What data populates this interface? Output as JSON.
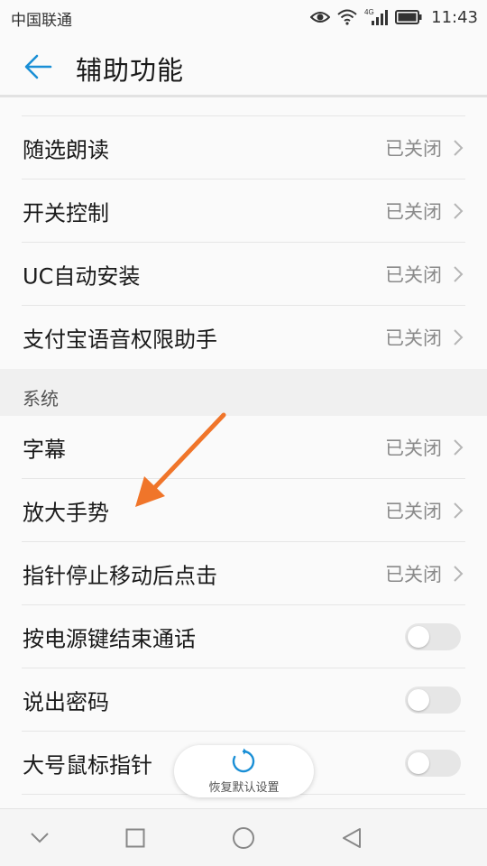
{
  "status_bar": {
    "carrier": "中国联通",
    "network_badge": "4G",
    "time": "11:43",
    "icons": [
      "eye-comfort-icon",
      "wifi-icon",
      "cellular-signal-icon",
      "battery-icon"
    ]
  },
  "app_bar": {
    "back_icon": "arrow-left-icon",
    "title": "辅助功能"
  },
  "colors": {
    "accent": "#1a8fd6",
    "annotation_arrow": "#f0752a",
    "value_text": "#8a8a8a",
    "section_bg": "#f0f0f0",
    "toggle_off": "#e6e6e6"
  },
  "list": {
    "items_top": [
      {
        "label": "随选朗读",
        "value": "已关闭"
      },
      {
        "label": "开关控制",
        "value": "已关闭"
      },
      {
        "label": "UC自动安装",
        "value": "已关闭"
      },
      {
        "label": "支付宝语音权限助手",
        "value": "已关闭"
      }
    ],
    "section_system": "系统",
    "items_system": [
      {
        "label": "字幕",
        "value": "已关闭"
      },
      {
        "label": "放大手势",
        "value": "已关闭"
      },
      {
        "label": "指针停止移动后点击",
        "value": "已关闭"
      }
    ],
    "toggles": [
      {
        "label": "按电源键结束通话",
        "on": false
      },
      {
        "label": "说出密码",
        "on": false
      },
      {
        "label": "大号鼠标指针",
        "on": false
      }
    ]
  },
  "restore_button": {
    "icon": "refresh-icon",
    "label": "恢复默认设置"
  },
  "nav_bar": {
    "icons": [
      "nav-hide-icon",
      "nav-recents-icon",
      "nav-home-icon",
      "nav-back-icon"
    ]
  }
}
